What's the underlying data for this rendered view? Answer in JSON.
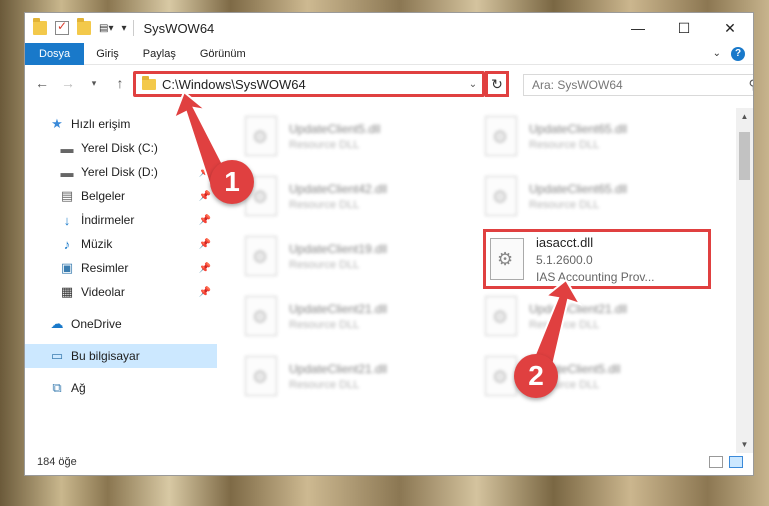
{
  "window": {
    "title": "SysWOW64"
  },
  "ribbon": {
    "tabs": [
      "Dosya",
      "Giriş",
      "Paylaş",
      "Görünüm"
    ]
  },
  "address": {
    "path": "C:\\Windows\\SysWOW64"
  },
  "search": {
    "placeholder": "Ara: SysWOW64"
  },
  "sidebar": {
    "quick_access": "Hızlı erişim",
    "items": [
      {
        "label": "Yerel Disk (C:)",
        "icon": "drive-icon"
      },
      {
        "label": "Yerel Disk (D:)",
        "icon": "drive-icon"
      },
      {
        "label": "Belgeler",
        "icon": "documents-icon"
      },
      {
        "label": "İndirmeler",
        "icon": "download-icon"
      },
      {
        "label": "Müzik",
        "icon": "music-icon"
      },
      {
        "label": "Resimler",
        "icon": "pictures-icon"
      },
      {
        "label": "Videolar",
        "icon": "video-icon"
      }
    ],
    "onedrive": "OneDrive",
    "this_pc": "Bu bilgisayar",
    "network": "Ağ"
  },
  "files": [
    {
      "name": "UpdateClient5.dll",
      "desc": "Resource DLL"
    },
    {
      "name": "UpdateClient65.dll",
      "desc": "Resource DLL"
    },
    {
      "name": "UpdateClient42.dll",
      "desc": "Resource DLL"
    },
    {
      "name": "UpdateClient65.dll",
      "desc": "Resource DLL"
    },
    {
      "name": "UpdateClient19.dll",
      "desc": "Resource DLL"
    },
    {
      "name": "UpdateClient21.dll",
      "desc": "Resource DLL"
    },
    {
      "name": "UpdateClient21.dll",
      "desc": "Resource DLL"
    },
    {
      "name": "UpdateClient21.dll",
      "desc": "Resource DLL"
    },
    {
      "name": "UpdateClient5.dll",
      "desc": "Resource DLL"
    }
  ],
  "highlighted_file": {
    "name": "iasacct.dll",
    "version": "5.1.2600.0",
    "desc": "IAS Accounting Prov..."
  },
  "annotations": {
    "step1": "1",
    "step2": "2"
  },
  "status": {
    "count": "184 öğe"
  },
  "colors": {
    "accent": "#1979ca",
    "highlight": "#e04040",
    "selection": "#cce8ff"
  }
}
